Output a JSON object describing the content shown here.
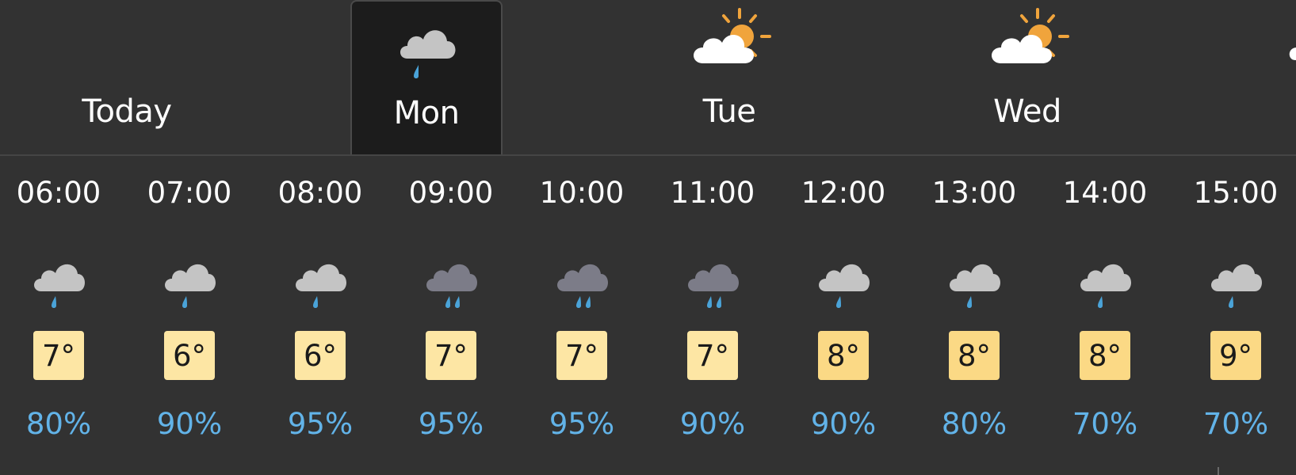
{
  "colors": {
    "background": "#323232",
    "selected_tab": "#1c1c1c",
    "precip_text": "#62b3e8",
    "temp_badge_light": "#fde6a4",
    "temp_badge_warm": "#fbd985",
    "cloud_light": "#c4c4c4",
    "cloud_dark": "#7c7c88",
    "rain_drop": "#4aa3d8",
    "sun": "#f0a43c"
  },
  "days": [
    {
      "label": "Today",
      "icon": "none",
      "selected": false
    },
    {
      "label": "Mon",
      "icon": "light-rain-icon",
      "selected": true
    },
    {
      "label": "Tue",
      "icon": "sunny-intervals-icon",
      "selected": false
    },
    {
      "label": "Wed",
      "icon": "sunny-intervals-icon",
      "selected": false
    }
  ],
  "hours": [
    {
      "time": "06:00",
      "icon": "light-rain-icon",
      "temp": "7°",
      "precip": "80%"
    },
    {
      "time": "07:00",
      "icon": "light-rain-icon",
      "temp": "6°",
      "precip": "90%"
    },
    {
      "time": "08:00",
      "icon": "light-rain-icon",
      "temp": "6°",
      "precip": "95%"
    },
    {
      "time": "09:00",
      "icon": "heavy-rain-icon",
      "temp": "7°",
      "precip": "95%"
    },
    {
      "time": "10:00",
      "icon": "heavy-rain-icon",
      "temp": "7°",
      "precip": "95%"
    },
    {
      "time": "11:00",
      "icon": "heavy-rain-icon",
      "temp": "7°",
      "precip": "90%"
    },
    {
      "time": "12:00",
      "icon": "light-rain-icon",
      "temp": "8°",
      "precip": "90%"
    },
    {
      "time": "13:00",
      "icon": "light-rain-icon",
      "temp": "8°",
      "precip": "80%"
    },
    {
      "time": "14:00",
      "icon": "light-rain-icon",
      "temp": "8°",
      "precip": "70%"
    },
    {
      "time": "15:00",
      "icon": "light-rain-icon",
      "temp": "9°",
      "precip": "70%"
    }
  ]
}
